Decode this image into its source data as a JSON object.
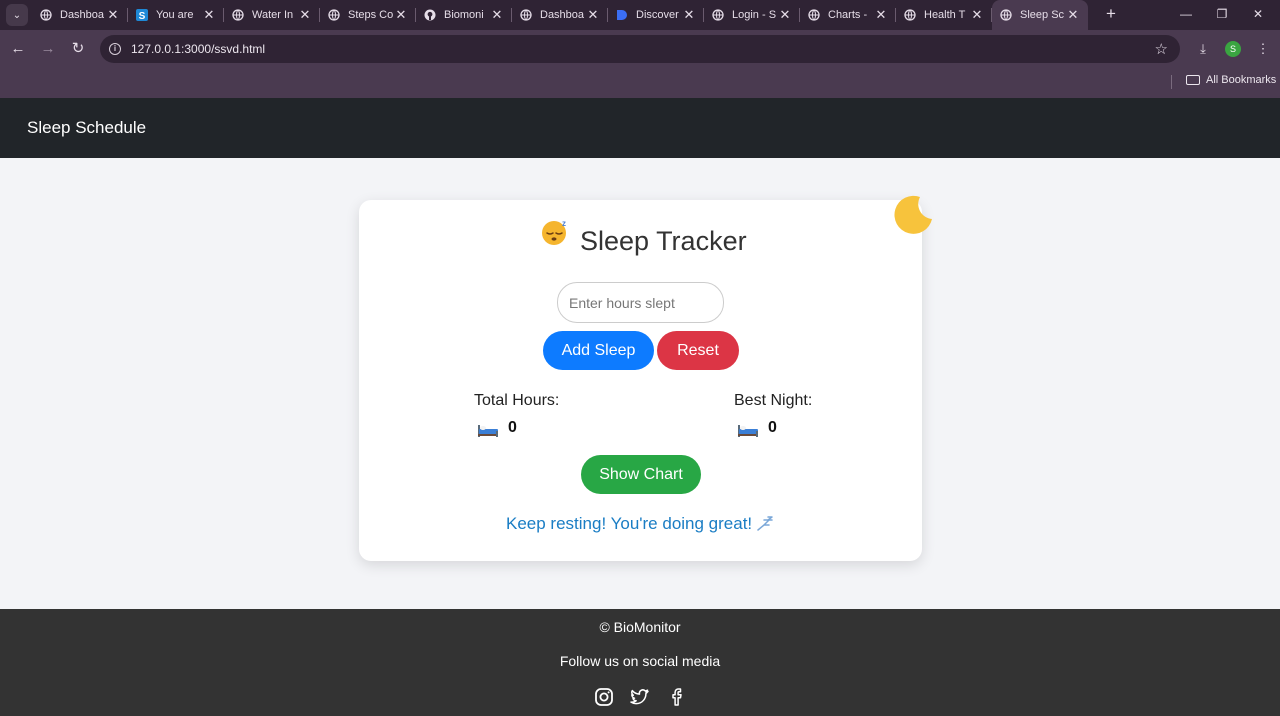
{
  "browser": {
    "tabs": [
      {
        "title": "Dashboa",
        "favicon": "globe-icon"
      },
      {
        "title": "You are",
        "favicon": "s-icon"
      },
      {
        "title": "Water In",
        "favicon": "globe-icon"
      },
      {
        "title": "Steps Co",
        "favicon": "globe-icon"
      },
      {
        "title": "Biomoni",
        "favicon": "github-icon"
      },
      {
        "title": "Dashboa",
        "favicon": "globe-icon"
      },
      {
        "title": "Discover",
        "favicon": "discover-icon"
      },
      {
        "title": "Login - S",
        "favicon": "globe-icon"
      },
      {
        "title": "Charts -",
        "favicon": "globe-icon"
      },
      {
        "title": "Health T",
        "favicon": "globe-icon"
      },
      {
        "title": "Sleep Sc",
        "favicon": "globe-icon",
        "active": true
      }
    ],
    "url": "127.0.0.1:3000/ssvd.html",
    "profile_initial": "S",
    "bookmarks_label": "All Bookmarks"
  },
  "header": {
    "title": "Sleep Schedule"
  },
  "tracker": {
    "title": "Sleep Tracker",
    "input_placeholder": "Enter hours slept",
    "input_value": "",
    "add_label": "Add Sleep",
    "reset_label": "Reset",
    "total_label": "Total Hours:",
    "total_value": "0",
    "best_label": "Best Night:",
    "best_value": "0",
    "chart_label": "Show Chart",
    "message": "Keep resting! You're doing great!"
  },
  "footer": {
    "copyright": "© BioMonitor",
    "follow": "Follow us on social media",
    "social": [
      "instagram-icon",
      "twitter-icon",
      "facebook-icon"
    ]
  },
  "colors": {
    "header_bg": "#212529",
    "footer_bg": "#333333",
    "add_button": "#0d7bff",
    "reset_button": "#dc3545",
    "chart_button": "#28a745",
    "message_text": "#1a7dc4"
  }
}
